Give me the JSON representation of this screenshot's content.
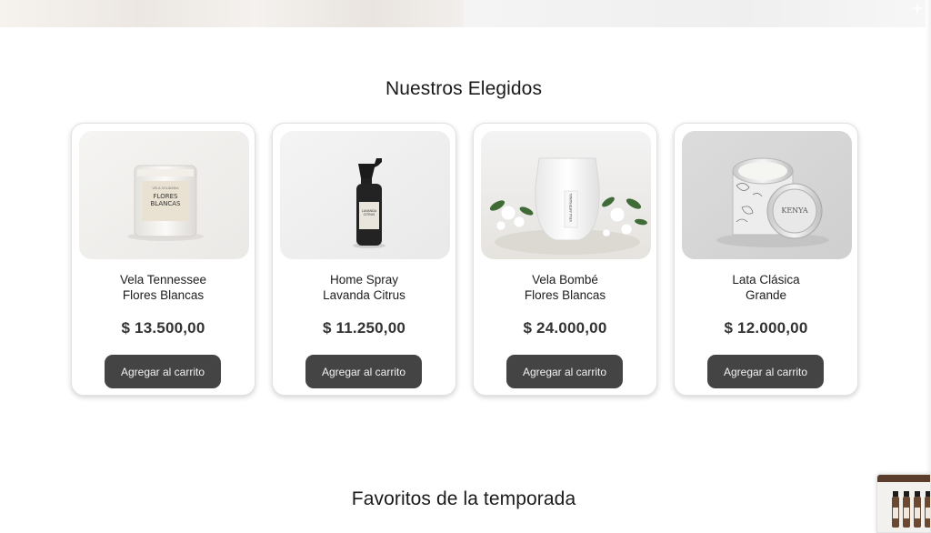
{
  "sections": {
    "featured_title": "Nuestros Elegidos",
    "season_title": "Favoritos de la temporada"
  },
  "products": [
    {
      "name_line1": "Vela Tennessee",
      "name_line2": "Flores Blancas",
      "price": "$ 13.500,00",
      "button_label": "Agregar al carrito",
      "image_label_top": "VELA SOLIDARIA",
      "image_label_main_1": "FLORES",
      "image_label_main_2": "BLANCAS"
    },
    {
      "name_line1": "Home Spray",
      "name_line2": "Lavanda Citrus",
      "price": "$ 11.250,00",
      "button_label": "Agregar al carrito",
      "image_label_main_1": "LAVANDA",
      "image_label_main_2": "CITRUS"
    },
    {
      "name_line1": "Vela Bombé",
      "name_line2": "Flores Blancas",
      "price": "$ 24.000,00",
      "button_label": "Agregar al carrito",
      "image_label_main_1": "VELA ARTESANAL"
    },
    {
      "name_line1": "Lata Clásica",
      "name_line2": "Grande",
      "price": "$ 12.000,00",
      "button_label": "Agregar al carrito",
      "image_label_main_1": "KENYA"
    }
  ],
  "colors": {
    "button_bg": "#444444",
    "button_text": "#f2f2f2",
    "price_text": "#333333",
    "title_text": "#1a1a1a"
  },
  "icons": {
    "hero_corner": "sparkle-icon"
  }
}
